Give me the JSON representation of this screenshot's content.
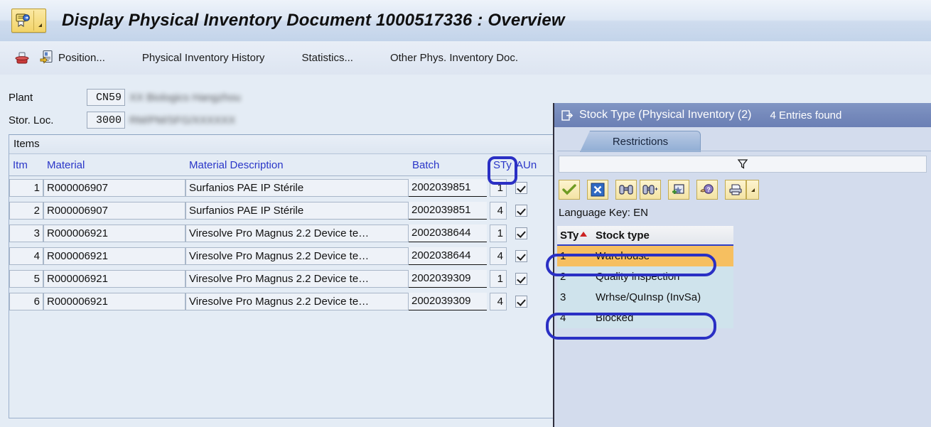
{
  "window": {
    "title": "Display Physical Inventory Document 1000517336 : Overview",
    "title_icon": "inventory-document-icon"
  },
  "toolbar": {
    "print_icon": "print-icon",
    "position_icon": "position-document-icon",
    "items": [
      {
        "label": "Position...",
        "icon": "position-document-icon"
      },
      {
        "label": "Physical Inventory History",
        "icon": ""
      },
      {
        "label": "Statistics...",
        "icon": ""
      },
      {
        "label": "Other Phys. Inventory Doc.",
        "icon": ""
      }
    ]
  },
  "form": {
    "plant_label": "Plant",
    "plant_value": "CN59",
    "plant_desc": "XX Biologics Hangzhou",
    "storloc_label": "Stor. Loc.",
    "storloc_value": "3000",
    "storloc_desc": "RM/PM/SFG/XXXXXX"
  },
  "items_panel": {
    "caption": "Items",
    "columns": [
      "Itm",
      "Material",
      "Material Description",
      "Batch",
      "STy",
      "AUn"
    ],
    "rows": [
      {
        "itm": "1",
        "material": "R000006907",
        "desc": "Surfanios PAE IP Stérile",
        "batch": "2002039851",
        "sty": "1",
        "aun": true
      },
      {
        "itm": "2",
        "material": "R000006907",
        "desc": "Surfanios PAE IP Stérile",
        "batch": "2002039851",
        "sty": "4",
        "aun": true
      },
      {
        "itm": "3",
        "material": "R000006921",
        "desc": "Viresolve Pro Magnus 2.2 Device te…",
        "batch": "2002038644",
        "sty": "1",
        "aun": true
      },
      {
        "itm": "4",
        "material": "R000006921",
        "desc": "Viresolve Pro Magnus 2.2 Device te…",
        "batch": "2002038644",
        "sty": "4",
        "aun": true
      },
      {
        "itm": "5",
        "material": "R000006921",
        "desc": "Viresolve Pro Magnus 2.2 Device te…",
        "batch": "2002039309",
        "sty": "1",
        "aun": true
      },
      {
        "itm": "6",
        "material": "R000006921",
        "desc": "Viresolve Pro Magnus 2.2 Device te…",
        "batch": "2002039309",
        "sty": "4",
        "aun": true
      }
    ]
  },
  "dialog": {
    "icon": "popup-window-icon",
    "title": "Stock Type (Physical Inventory (2)",
    "entries_found": "4 Entries found",
    "tab_label": "Restrictions",
    "filter_icon": "funnel-filter-icon",
    "toolbar_buttons": [
      {
        "name": "confirm-check-icon",
        "label": ""
      },
      {
        "name": "cancel-x-icon",
        "label": ""
      },
      {
        "name": "find-binoculars-icon",
        "label": ""
      },
      {
        "name": "find-next-binoculars-icon",
        "label": ""
      },
      {
        "name": "new-selection-icon",
        "label": ""
      },
      {
        "name": "help-icon",
        "label": ""
      },
      {
        "name": "print-icon",
        "label": ""
      },
      {
        "name": "print-dropdown-icon",
        "label": ""
      }
    ],
    "language_key": "Language Key: EN",
    "columns": [
      "STy",
      "Stock type"
    ],
    "rows": [
      {
        "sty": "1",
        "name": "Warehouse",
        "selected": true
      },
      {
        "sty": "2",
        "name": "Quality inspection",
        "selected": false
      },
      {
        "sty": "3",
        "name": "Wrhse/QuInsp (InvSa)",
        "selected": false
      },
      {
        "sty": "4",
        "name": "Blocked",
        "selected": false
      }
    ]
  },
  "annotations": {
    "color": "#2a2fc4",
    "marks": [
      {
        "name": "sty-column-header-highlight",
        "target": "STy"
      },
      {
        "name": "warehouse-row-highlight",
        "target": "1 Warehouse"
      },
      {
        "name": "blocked-row-highlight",
        "target": "4 Blocked"
      }
    ]
  }
}
